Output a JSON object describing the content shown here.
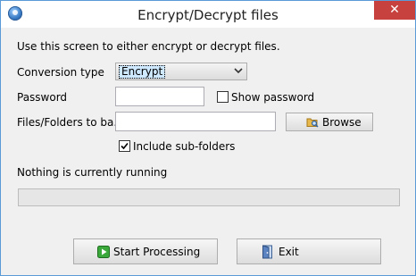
{
  "window": {
    "title": "Encrypt/Decrypt files",
    "close_glyph": "✕"
  },
  "form": {
    "instruction": "Use this screen to either encrypt or decrypt files.",
    "conversion_type_label": "Conversion type",
    "conversion_type_value": "Encrypt",
    "password_label": "Password",
    "password_value": "",
    "show_password_label": "Show password",
    "show_password_checked": false,
    "files_label": "Files/Folders to ba...",
    "files_value": "",
    "browse_label": "Browse",
    "include_subfolders_label": "Include sub-folders",
    "include_subfolders_checked": true
  },
  "status": {
    "text": "Nothing is currently running",
    "progress": 0
  },
  "buttons": {
    "start_label": "Start Processing",
    "exit_label": "Exit"
  },
  "icons": {
    "app": "app-globe-icon",
    "browse": "folder-search-icon",
    "start": "play-icon",
    "exit": "exit-door-icon"
  }
}
